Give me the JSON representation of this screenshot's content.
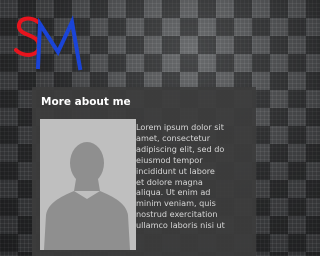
{
  "logo": {
    "text": "SM",
    "colors": {
      "s": "#e8141e",
      "m": "#1a44d8"
    }
  },
  "widget": {
    "title": "More about me",
    "avatar_icon": "person-silhouette-icon",
    "bio_lines": [
      "Lorem ipsum dolor sit",
      "amet, consectetur",
      "adipiscing elit, sed do",
      "eiusmod tempor",
      "incididunt ut labore",
      "et dolore magna",
      "aliqua. Ut enim ad",
      "minim veniam, quis",
      "nostrud exercitation",
      "ullamco laboris nisi ut"
    ]
  }
}
